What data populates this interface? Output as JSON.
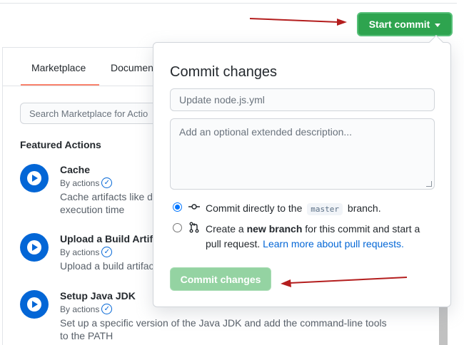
{
  "header": {
    "start_commit_label": "Start commit"
  },
  "tabs": [
    {
      "label": "Marketplace"
    },
    {
      "label": "Documen"
    }
  ],
  "search": {
    "placeholder": "Search Marketplace for Actio"
  },
  "featured_heading": "Featured Actions",
  "actions": [
    {
      "name": "Cache",
      "by": "By actions",
      "desc": "Cache artifacts like de\nexecution time"
    },
    {
      "name": "Upload a Build Artifa",
      "by": "By actions",
      "desc": "Upload a build artifac"
    },
    {
      "name": "Setup Java JDK",
      "by": "By actions",
      "desc": "Set up a specific version of the Java JDK and add the command-line tools to the PATH"
    }
  ],
  "commit_dialog": {
    "title": "Commit changes",
    "summary_placeholder": "Update node.js.yml",
    "description_placeholder": "Add an optional extended description...",
    "option_direct": {
      "before": "Commit directly to the",
      "branch": "master",
      "after": "branch."
    },
    "option_new": {
      "before": "Create a",
      "bold": "new branch",
      "after": "for this commit and start a pull request.",
      "link": "Learn more about pull requests."
    },
    "commit_button": "Commit changes"
  },
  "colors": {
    "primary_green": "#2ea44f",
    "disabled_green": "#94d3a2",
    "link_blue": "#0366d6",
    "annotation_red": "#b41e1e"
  }
}
